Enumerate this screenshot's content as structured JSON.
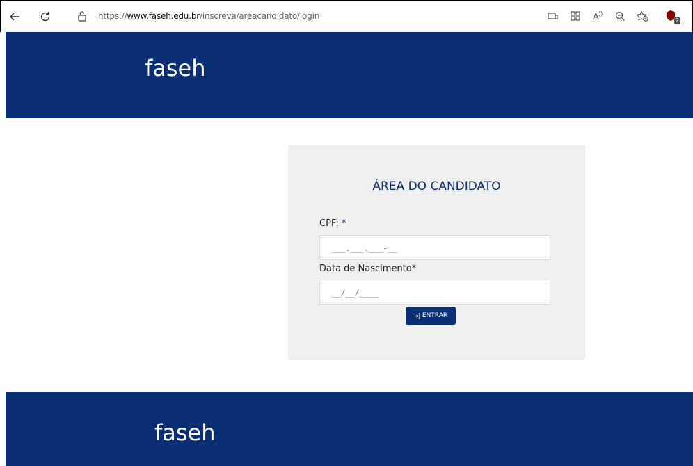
{
  "browser": {
    "url_prefix": "https://",
    "url_host": "www.faseh.edu.br",
    "url_path": "/inscreva/areacandidato/login",
    "icons": [
      "back-icon",
      "refresh-icon",
      "lock-icon",
      "device-icon",
      "grid-icon",
      "read-aloud-icon",
      "zoom-out-icon",
      "favorites-icon",
      "extension-icon"
    ],
    "extension_badge": "2"
  },
  "header": {
    "logo_text": "faseh"
  },
  "login": {
    "title": "ÁREA DO CANDIDATO",
    "cpf_label": "CPF:",
    "cpf_required": "*",
    "cpf_placeholder": "___.___.___-__",
    "birth_label": "Data de Nascimento",
    "birth_required": "*",
    "birth_placeholder": "__/__/____",
    "submit_label": "ENTRAR"
  },
  "footer": {
    "logo_text": "faseh"
  },
  "colors": {
    "brand": "#0b2f75",
    "card_bg": "#efefef"
  }
}
